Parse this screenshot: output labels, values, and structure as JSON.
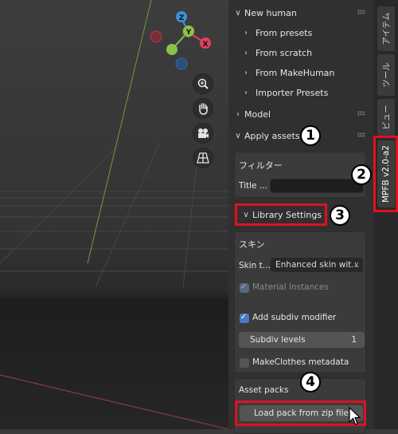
{
  "gizmo": {
    "z": "Z",
    "y": "Y",
    "x": "X"
  },
  "viewport_tools": [
    "zoom-icon",
    "hand-pan-icon",
    "camera-icon",
    "perspective-grid-icon"
  ],
  "sidebar": {
    "new_human": {
      "title": "New human",
      "items": [
        "From presets",
        "From scratch",
        "From MakeHuman",
        "Importer Presets"
      ]
    },
    "model": {
      "title": "Model"
    },
    "apply_assets": {
      "title": "Apply assets",
      "filter": {
        "heading": "フィルター",
        "title_label": "Title ...",
        "title_value": ""
      },
      "library_settings": {
        "label": "Library Settings"
      },
      "skin": {
        "heading": "スキン",
        "skin_type_label": "Skin t...",
        "skin_type_value": "Enhanced skin wit...",
        "material_instances": {
          "label": "Material instances",
          "checked": true,
          "enabled": false
        },
        "add_subdiv": {
          "label": "Add subdiv modifier",
          "checked": true
        },
        "subdiv_levels": {
          "label": "Subdiv levels",
          "value": "1"
        },
        "makeclothes_metadata": {
          "label": "MakeClothes metadata",
          "checked": false
        }
      },
      "asset_packs": {
        "heading": "Asset packs",
        "load_button": "Load pack from zip file"
      }
    }
  },
  "tabs": [
    {
      "label": "アイテム",
      "active": false
    },
    {
      "label": "ツール",
      "active": false
    },
    {
      "label": "ビュー",
      "active": false
    },
    {
      "label": "MPFB v2.0-a2",
      "active": true
    }
  ],
  "annotations": [
    "1",
    "2",
    "3",
    "4"
  ],
  "colors": {
    "highlight": "#e01020",
    "checkbox": "#4b79c3",
    "axis_x": "#e0415a",
    "axis_y": "#8bc34a",
    "axis_z": "#3f8fdb"
  }
}
